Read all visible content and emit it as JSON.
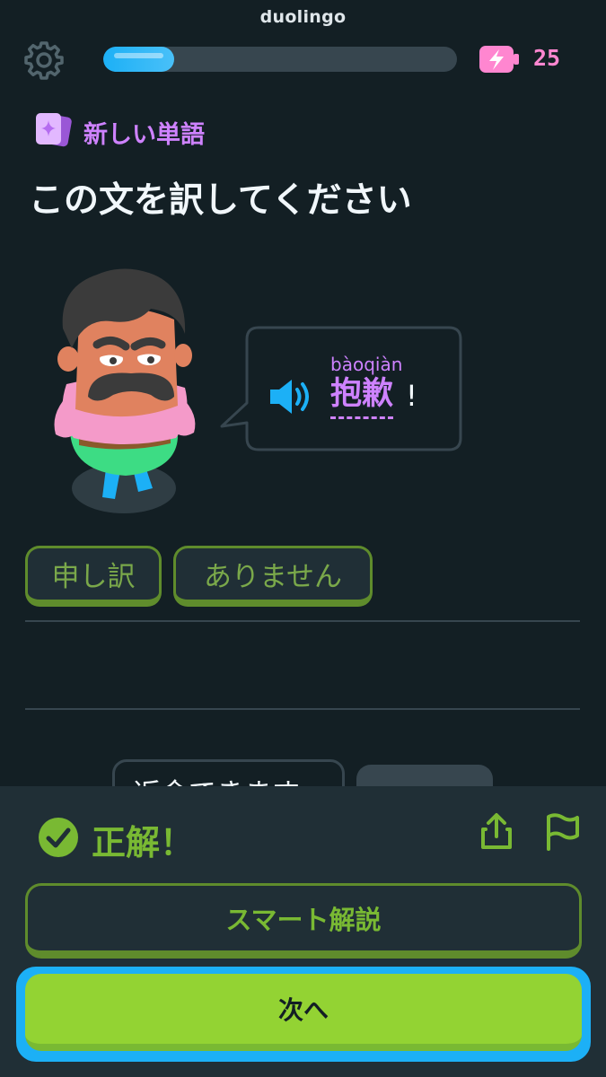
{
  "app": {
    "title": "duolingo"
  },
  "progress": {
    "fraction": 0.2
  },
  "energy": {
    "count": "25"
  },
  "header": {
    "badge_label": "新しい単語",
    "instruction": "この文を訳してください"
  },
  "prompt": {
    "pinyin": "bàoqiàn",
    "hanzi": "抱歉",
    "punctuation": "!"
  },
  "answer": {
    "chips": [
      "申し訳",
      "ありません"
    ]
  },
  "word_bank": {
    "visible_chip": "返金できます"
  },
  "feedback": {
    "status": "正解！",
    "explain_button": "スマート解説",
    "next_button": "次へ"
  },
  "colors": {
    "background": "#131f24",
    "sheet": "#202f36",
    "accent_green": "#79b933",
    "button_green": "#93d333",
    "accent_blue": "#1cb0f6",
    "accent_purple": "#ce82ff",
    "energy_pink": "#ff86d0"
  },
  "icons": {
    "settings": "gear-icon",
    "energy": "battery-bolt-icon",
    "new_word": "card-sparkle-icon",
    "audio": "speaker-icon",
    "status": "checkmark-circle-icon",
    "share": "share-icon",
    "report": "flag-icon"
  }
}
